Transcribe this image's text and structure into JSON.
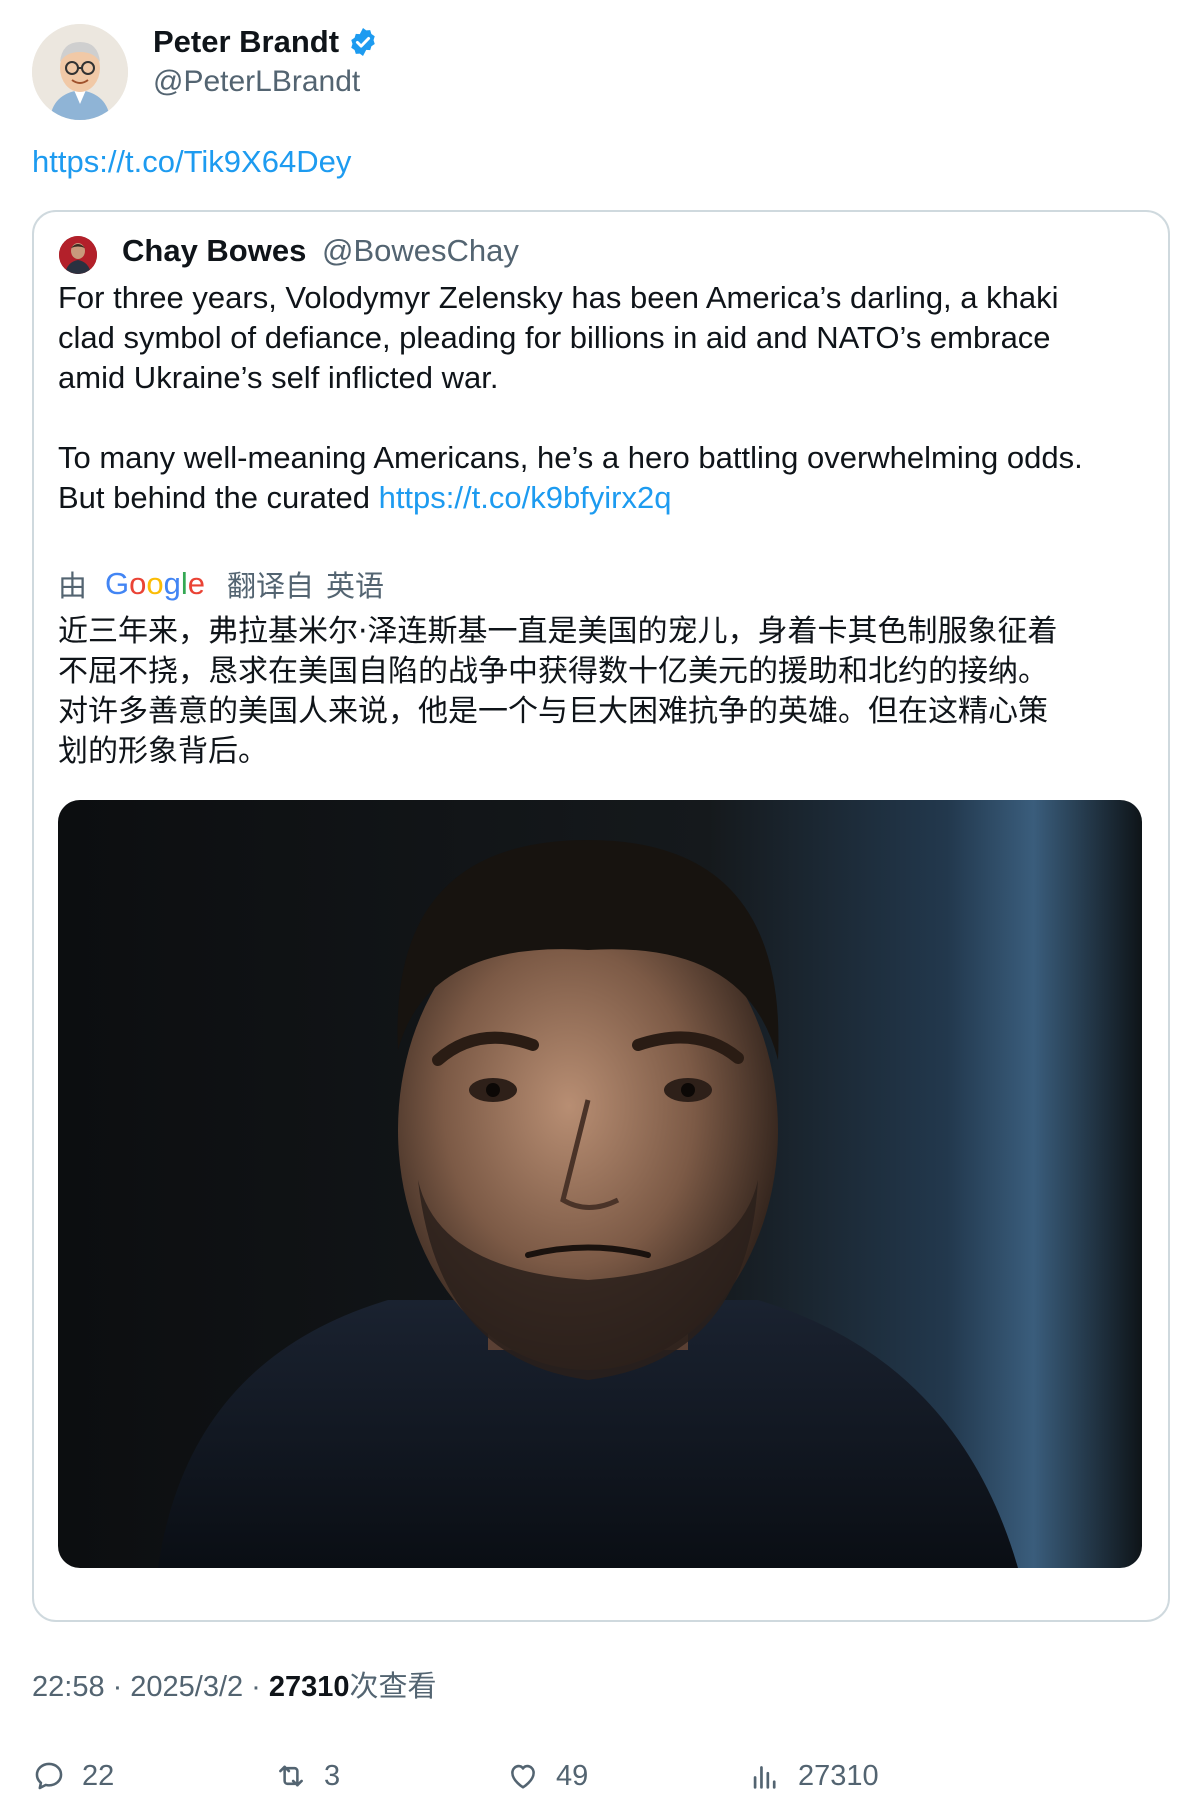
{
  "author": {
    "name": "Peter Brandt",
    "handle": "@PeterLBrandt",
    "verified": true
  },
  "tweet": {
    "link": "https://t.co/Tik9X64Dey"
  },
  "quote": {
    "name": "Chay Bowes",
    "handle": "@BowesChay",
    "paragraph1_lines": [
      "For three years, Volodymyr Zelensky has been America’s darling, a khaki",
      "clad symbol of defiance, pleading for billions in aid and NATO’s embrace",
      "amid Ukraine’s self inflicted war."
    ],
    "paragraph2_line1": "To many well-meaning Americans, he’s a hero battling overwhelming odds.",
    "paragraph2_line2_prefix": "But behind the curated ",
    "paragraph2_link": "https://t.co/k9bfyirx2q",
    "translation_by": "由",
    "translation_provider": "Google",
    "translation_from": "翻译自",
    "translation_language": "英语",
    "translated_lines": [
      "近三年来，弗拉基米尔·泽连斯基一直是美国的宠儿，身着卡其色制服象征着",
      "不屈不挠，恳求在美国自陷的战争中获得数十亿美元的援助和北约的接纳。",
      "对许多善意的美国人来说，他是一个与巨大困难抗争的英雄。但在这精心策",
      "划的形象背后。"
    ]
  },
  "meta": {
    "time": "22:58",
    "date": "2025/3/2",
    "views_count": "27310",
    "views_label": "次查看"
  },
  "actions": {
    "replies": "22",
    "retweets": "3",
    "likes": "49",
    "views": "27310"
  },
  "colors": {
    "link": "#1d9bf0",
    "secondary_text": "#536471",
    "border": "#cfd9de",
    "verified": "#1d9bf0"
  }
}
